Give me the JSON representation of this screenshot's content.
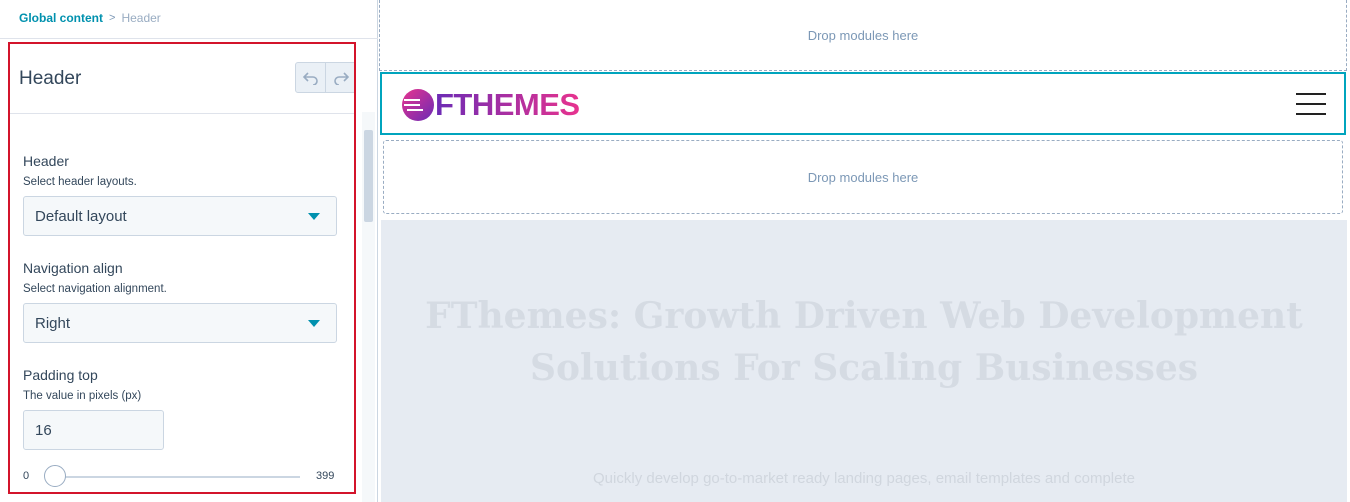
{
  "breadcrumb": {
    "parent": "Global content",
    "separator": ">",
    "current": "Header"
  },
  "panel": {
    "title": "Header",
    "undo_icon": "undo-icon",
    "redo_icon": "redo-icon",
    "fields": {
      "header_layout": {
        "label": "Header",
        "help": "Select header layouts.",
        "value": "Default layout"
      },
      "nav_align": {
        "label": "Navigation align",
        "help": "Select navigation alignment.",
        "value": "Right"
      },
      "padding_top": {
        "label": "Padding top",
        "help": "The value in pixels (px)",
        "value": "16",
        "min": "0",
        "max": "399"
      }
    }
  },
  "preview": {
    "drop_top": "Drop modules here",
    "drop_bottom": "Drop modules here",
    "logo_text": "FTHEMES",
    "hero_title": "FThemes: Growth Driven Web Development Solutions For Scaling Businesses",
    "hero_subtitle": "Quickly develop go-to-market ready landing pages, email templates and complete",
    "colors": {
      "selected_outline": "#00a4bd",
      "panel_outline": "#d3142b",
      "logo_start": "#6b2bb5",
      "logo_end": "#e8338e",
      "accent": "#0091ae"
    }
  }
}
